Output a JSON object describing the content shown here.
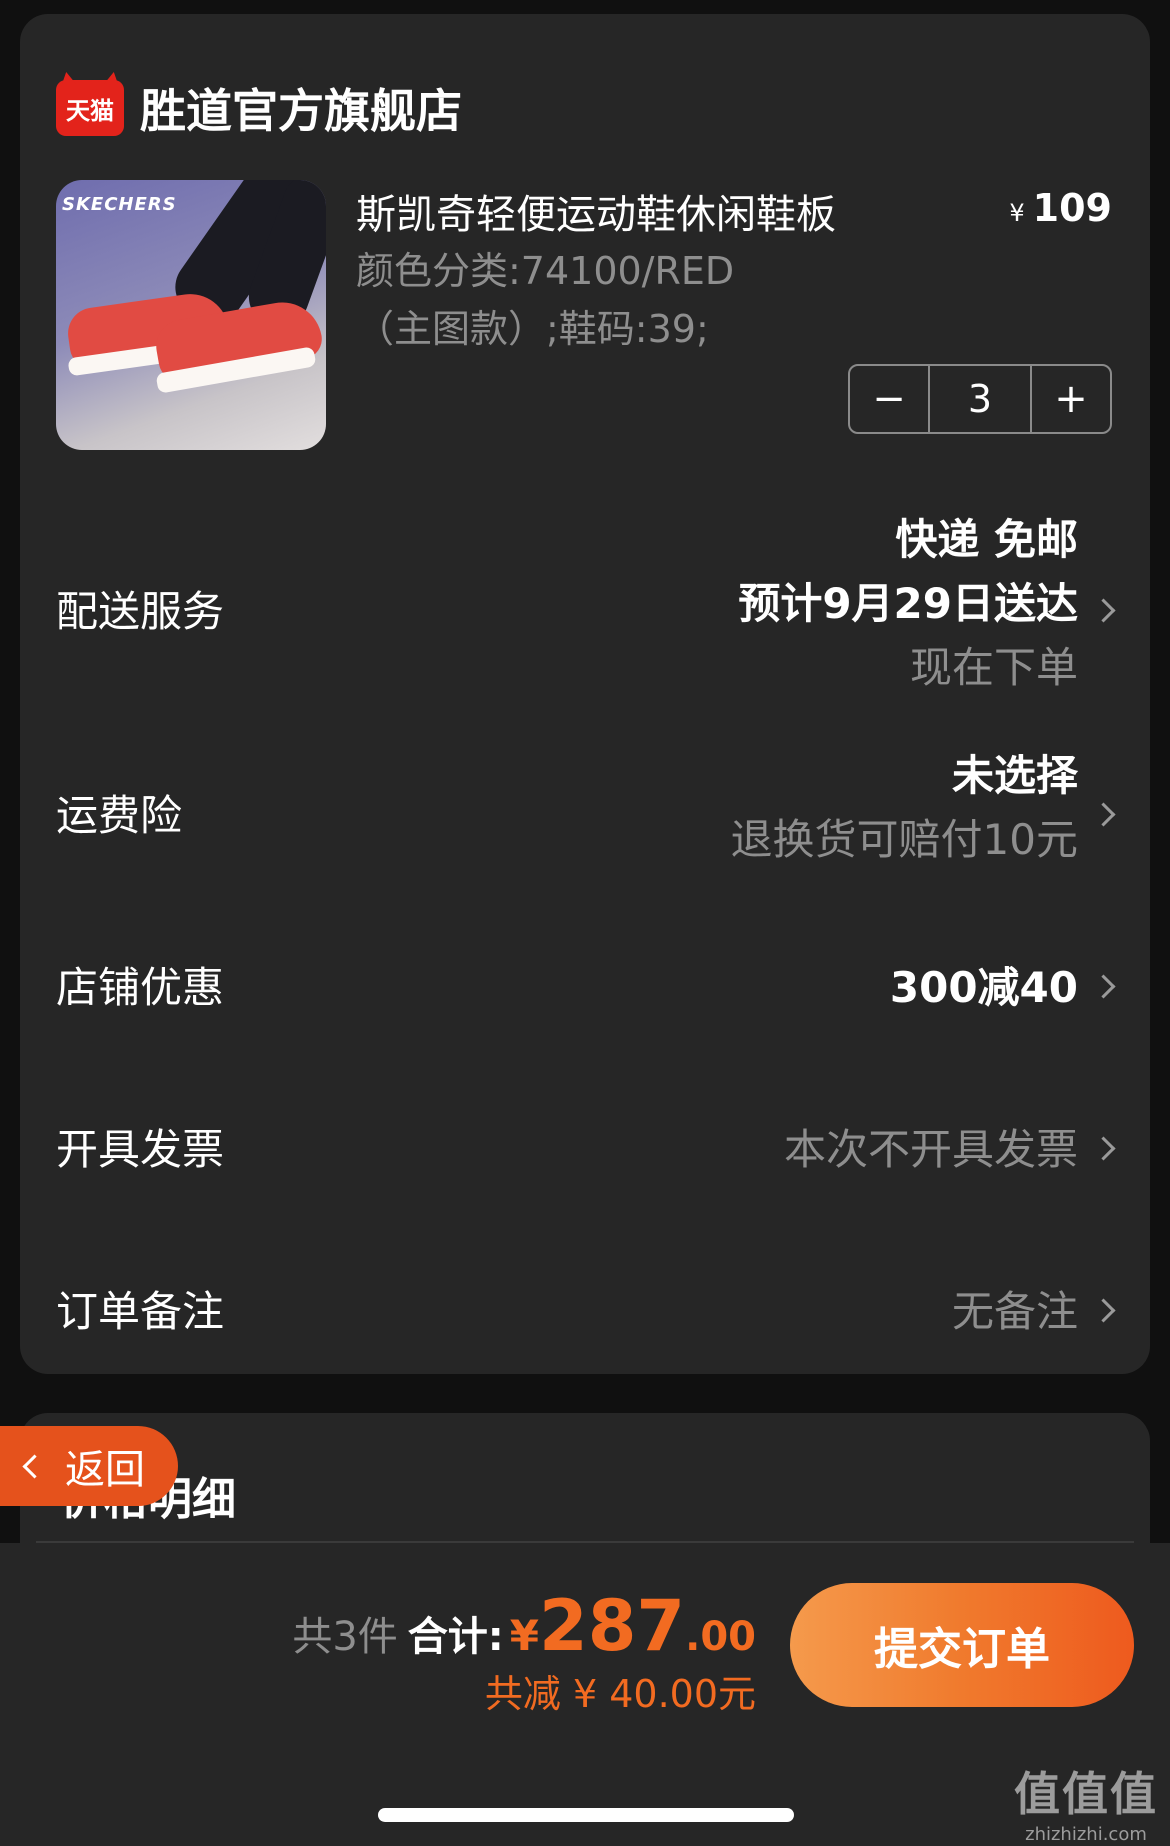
{
  "shop": {
    "badge": "天猫",
    "name": "胜道官方旗舰店"
  },
  "product": {
    "brand": "SKECHERS",
    "title": "斯凯奇轻便运动鞋休闲鞋板",
    "price_symbol": "¥",
    "price": "109",
    "spec_line1": "颜色分类:74100/RED",
    "spec_line2": "（主图款）;鞋码:39;",
    "quantity": "3",
    "minus": "−",
    "plus": "+"
  },
  "rows": {
    "delivery": {
      "label": "配送服务",
      "line1": "快递 免邮",
      "line2": "预计9月29日送达",
      "line3": "现在下单"
    },
    "freight_insurance": {
      "label": "运费险",
      "line1": "未选择",
      "line2": "退换货可赔付10元"
    },
    "shop_discount": {
      "label": "店铺优惠",
      "value": "300减40"
    },
    "invoice": {
      "label": "开具发票",
      "value": "本次不开具发票"
    },
    "note": {
      "label": "订单备注",
      "value": "无备注"
    }
  },
  "price_detail": {
    "title": "价格明细"
  },
  "back": {
    "label": "返回"
  },
  "footer": {
    "count": "共3件",
    "total_label": "合计:",
    "currency": "¥",
    "total_int": "287",
    "total_dec": ".00",
    "discount": "共减 ¥ 40.00元",
    "submit": "提交订单"
  },
  "watermark": {
    "big": "值值值",
    "small": "zhizhizhi.com"
  },
  "colors": {
    "accent": "#f26b21",
    "card": "#262626",
    "background": "#101010",
    "tmall_red": "#e3231b"
  }
}
